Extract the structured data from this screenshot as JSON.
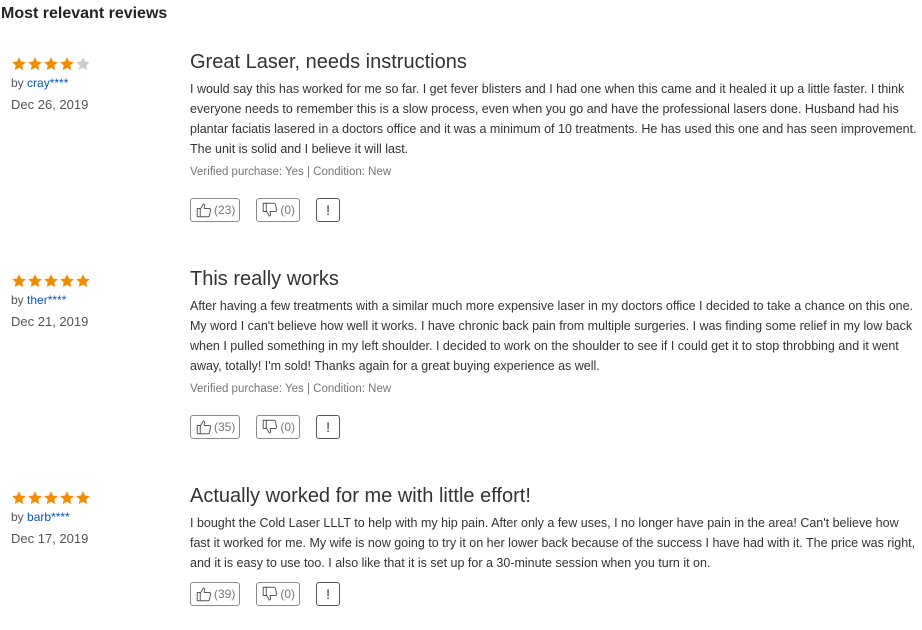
{
  "section_title": "Most relevant reviews",
  "colors": {
    "star_filled": "#f18c00",
    "star_empty": "#cccccc",
    "username_link": "#0654ba"
  },
  "reviews": [
    {
      "rating": 4,
      "rating_max": 5,
      "by_prefix": "by",
      "username": "cray****",
      "date": "Dec 26, 2019",
      "title": "Great Laser, needs instructions",
      "text": "I would say this has worked for me so far. I get fever blisters and I had one when this came and it healed it up a little faster. I think everyone needs to remember this is a slow process, even when you go and have the professional lasers done. Husband had his plantar faciatis lasered in a doctors office and it was a minimum of 10 treatments. He has used this one and has seen improvement. The unit is solid and I believe it will last.",
      "verified": "Verified purchase: Yes | Condition: New",
      "helpful_count": "(23)",
      "unhelpful_count": "(0)",
      "report_label": "!"
    },
    {
      "rating": 5,
      "rating_max": 5,
      "by_prefix": "by",
      "username": "ther****",
      "date": "Dec 21, 2019",
      "title": "This really works",
      "text": "After having a few treatments with a similar much more expensive laser in my doctors office I decided to take a chance on this one. My word I can't believe how well it works. I have chronic back pain from multiple surgeries. I was finding some relief in my low back when I pulled something in my left shoulder. I decided to work on the shoulder to see if I could get it to stop throbbing and it went away, totally! I'm sold! Thanks again for a great buying experience as well.",
      "verified": "Verified purchase: Yes | Condition: New",
      "helpful_count": "(35)",
      "unhelpful_count": "(0)",
      "report_label": "!"
    },
    {
      "rating": 5,
      "rating_max": 5,
      "by_prefix": "by",
      "username": "barb****",
      "date": "Dec 17, 2019",
      "title": "Actually worked for me with little effort!",
      "text": "I bought the Cold Laser LLLT to help with my hip pain.  After only a few uses, I no longer have pain in the area!  Can't believe how fast it worked for me.  My wife is now going to try it on her lower back because of the success I have had with it.  The price was right, and it is easy to use too. I also like that it is set up for a 30-minute session when you turn it on.",
      "verified": "",
      "helpful_count": "(39)",
      "unhelpful_count": "(0)",
      "report_label": "!"
    }
  ]
}
